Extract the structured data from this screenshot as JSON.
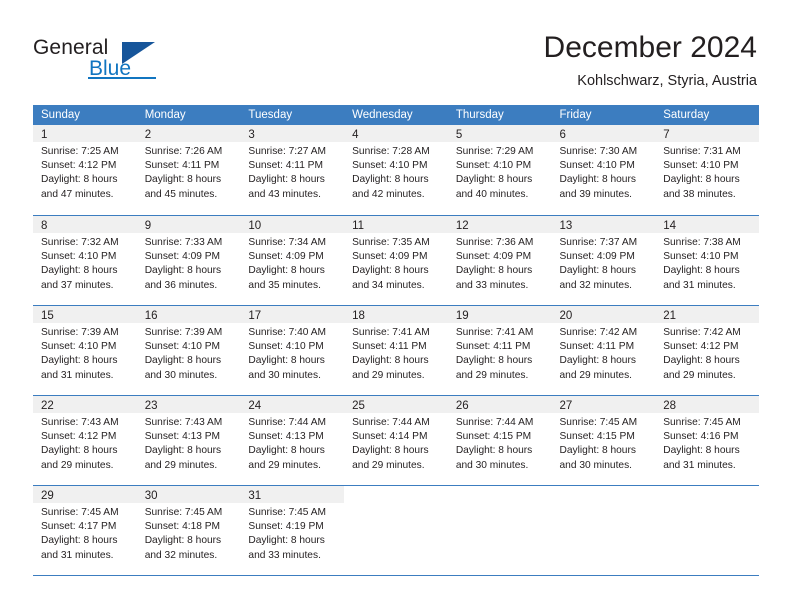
{
  "brand": {
    "name_part1": "General",
    "name_part2": "Blue",
    "triangle_icon": "blue-triangle-icon",
    "accent_color": "#1175c0",
    "accent_dark": "#16559a"
  },
  "header": {
    "title": "December 2024",
    "subtitle": "Kohlschwarz, Styria, Austria"
  },
  "calendar": {
    "header_bg": "#3c7dc0",
    "daynum_bg": "#f0f0f0",
    "weekdays": [
      "Sunday",
      "Monday",
      "Tuesday",
      "Wednesday",
      "Thursday",
      "Friday",
      "Saturday"
    ],
    "weeks": [
      [
        {
          "day": "1",
          "lines": [
            "Sunrise: 7:25 AM",
            "Sunset: 4:12 PM",
            "Daylight: 8 hours",
            "and 47 minutes."
          ]
        },
        {
          "day": "2",
          "lines": [
            "Sunrise: 7:26 AM",
            "Sunset: 4:11 PM",
            "Daylight: 8 hours",
            "and 45 minutes."
          ]
        },
        {
          "day": "3",
          "lines": [
            "Sunrise: 7:27 AM",
            "Sunset: 4:11 PM",
            "Daylight: 8 hours",
            "and 43 minutes."
          ]
        },
        {
          "day": "4",
          "lines": [
            "Sunrise: 7:28 AM",
            "Sunset: 4:10 PM",
            "Daylight: 8 hours",
            "and 42 minutes."
          ]
        },
        {
          "day": "5",
          "lines": [
            "Sunrise: 7:29 AM",
            "Sunset: 4:10 PM",
            "Daylight: 8 hours",
            "and 40 minutes."
          ]
        },
        {
          "day": "6",
          "lines": [
            "Sunrise: 7:30 AM",
            "Sunset: 4:10 PM",
            "Daylight: 8 hours",
            "and 39 minutes."
          ]
        },
        {
          "day": "7",
          "lines": [
            "Sunrise: 7:31 AM",
            "Sunset: 4:10 PM",
            "Daylight: 8 hours",
            "and 38 minutes."
          ]
        }
      ],
      [
        {
          "day": "8",
          "lines": [
            "Sunrise: 7:32 AM",
            "Sunset: 4:10 PM",
            "Daylight: 8 hours",
            "and 37 minutes."
          ]
        },
        {
          "day": "9",
          "lines": [
            "Sunrise: 7:33 AM",
            "Sunset: 4:09 PM",
            "Daylight: 8 hours",
            "and 36 minutes."
          ]
        },
        {
          "day": "10",
          "lines": [
            "Sunrise: 7:34 AM",
            "Sunset: 4:09 PM",
            "Daylight: 8 hours",
            "and 35 minutes."
          ]
        },
        {
          "day": "11",
          "lines": [
            "Sunrise: 7:35 AM",
            "Sunset: 4:09 PM",
            "Daylight: 8 hours",
            "and 34 minutes."
          ]
        },
        {
          "day": "12",
          "lines": [
            "Sunrise: 7:36 AM",
            "Sunset: 4:09 PM",
            "Daylight: 8 hours",
            "and 33 minutes."
          ]
        },
        {
          "day": "13",
          "lines": [
            "Sunrise: 7:37 AM",
            "Sunset: 4:09 PM",
            "Daylight: 8 hours",
            "and 32 minutes."
          ]
        },
        {
          "day": "14",
          "lines": [
            "Sunrise: 7:38 AM",
            "Sunset: 4:10 PM",
            "Daylight: 8 hours",
            "and 31 minutes."
          ]
        }
      ],
      [
        {
          "day": "15",
          "lines": [
            "Sunrise: 7:39 AM",
            "Sunset: 4:10 PM",
            "Daylight: 8 hours",
            "and 31 minutes."
          ]
        },
        {
          "day": "16",
          "lines": [
            "Sunrise: 7:39 AM",
            "Sunset: 4:10 PM",
            "Daylight: 8 hours",
            "and 30 minutes."
          ]
        },
        {
          "day": "17",
          "lines": [
            "Sunrise: 7:40 AM",
            "Sunset: 4:10 PM",
            "Daylight: 8 hours",
            "and 30 minutes."
          ]
        },
        {
          "day": "18",
          "lines": [
            "Sunrise: 7:41 AM",
            "Sunset: 4:11 PM",
            "Daylight: 8 hours",
            "and 29 minutes."
          ]
        },
        {
          "day": "19",
          "lines": [
            "Sunrise: 7:41 AM",
            "Sunset: 4:11 PM",
            "Daylight: 8 hours",
            "and 29 minutes."
          ]
        },
        {
          "day": "20",
          "lines": [
            "Sunrise: 7:42 AM",
            "Sunset: 4:11 PM",
            "Daylight: 8 hours",
            "and 29 minutes."
          ]
        },
        {
          "day": "21",
          "lines": [
            "Sunrise: 7:42 AM",
            "Sunset: 4:12 PM",
            "Daylight: 8 hours",
            "and 29 minutes."
          ]
        }
      ],
      [
        {
          "day": "22",
          "lines": [
            "Sunrise: 7:43 AM",
            "Sunset: 4:12 PM",
            "Daylight: 8 hours",
            "and 29 minutes."
          ]
        },
        {
          "day": "23",
          "lines": [
            "Sunrise: 7:43 AM",
            "Sunset: 4:13 PM",
            "Daylight: 8 hours",
            "and 29 minutes."
          ]
        },
        {
          "day": "24",
          "lines": [
            "Sunrise: 7:44 AM",
            "Sunset: 4:13 PM",
            "Daylight: 8 hours",
            "and 29 minutes."
          ]
        },
        {
          "day": "25",
          "lines": [
            "Sunrise: 7:44 AM",
            "Sunset: 4:14 PM",
            "Daylight: 8 hours",
            "and 29 minutes."
          ]
        },
        {
          "day": "26",
          "lines": [
            "Sunrise: 7:44 AM",
            "Sunset: 4:15 PM",
            "Daylight: 8 hours",
            "and 30 minutes."
          ]
        },
        {
          "day": "27",
          "lines": [
            "Sunrise: 7:45 AM",
            "Sunset: 4:15 PM",
            "Daylight: 8 hours",
            "and 30 minutes."
          ]
        },
        {
          "day": "28",
          "lines": [
            "Sunrise: 7:45 AM",
            "Sunset: 4:16 PM",
            "Daylight: 8 hours",
            "and 31 minutes."
          ]
        }
      ],
      [
        {
          "day": "29",
          "lines": [
            "Sunrise: 7:45 AM",
            "Sunset: 4:17 PM",
            "Daylight: 8 hours",
            "and 31 minutes."
          ]
        },
        {
          "day": "30",
          "lines": [
            "Sunrise: 7:45 AM",
            "Sunset: 4:18 PM",
            "Daylight: 8 hours",
            "and 32 minutes."
          ]
        },
        {
          "day": "31",
          "lines": [
            "Sunrise: 7:45 AM",
            "Sunset: 4:19 PM",
            "Daylight: 8 hours",
            "and 33 minutes."
          ]
        },
        {
          "day": "",
          "lines": []
        },
        {
          "day": "",
          "lines": []
        },
        {
          "day": "",
          "lines": []
        },
        {
          "day": "",
          "lines": []
        }
      ]
    ]
  }
}
